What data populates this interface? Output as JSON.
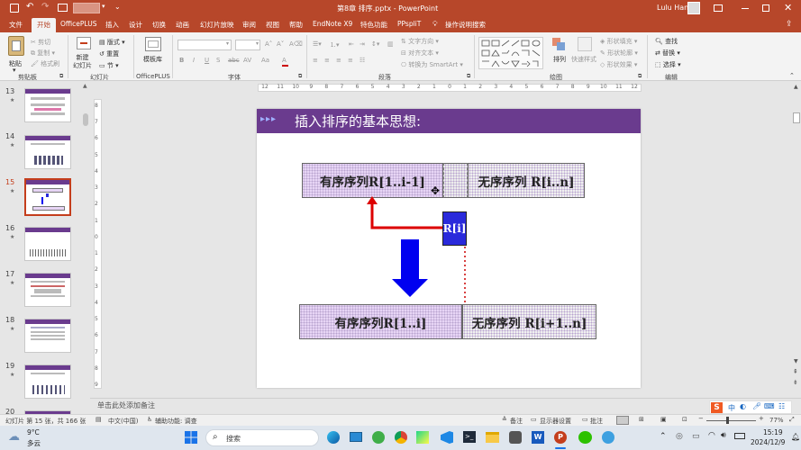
{
  "titlebar": {
    "doc_title": "第8章 排序.pptx - PowerPoint",
    "user": "Lulu Han"
  },
  "tabs": [
    "文件",
    "开始",
    "OfficePLUS",
    "插入",
    "设计",
    "切换",
    "动画",
    "幻灯片放映",
    "审阅",
    "视图",
    "帮助",
    "EndNote X9",
    "特色功能",
    "PPspliT",
    "操作说明搜索"
  ],
  "ribbon": {
    "paste": "粘贴",
    "cut": "剪切",
    "copy": "复制",
    "format_painter": "格式刷",
    "new_slide": "新建\n幻灯片",
    "layout": "版式",
    "reset": "重置",
    "section": "节",
    "template_lib": "模板库",
    "font_name": "",
    "font_size": "",
    "text_direction": "文字方向",
    "align_text": "对齐文本",
    "smartart": "转换为 SmartArt",
    "arrange": "排列",
    "quick_styles": "快速样式",
    "shape_fill": "形状填充",
    "shape_outline": "形状轮廓",
    "shape_effects": "形状效果",
    "find": "查找",
    "replace": "替换",
    "select": "选择",
    "groups": {
      "clipboard": "剪贴板",
      "slides": "幻灯片",
      "officeplus": "OfficePLUS",
      "font": "字体",
      "paragraph": "段落",
      "drawing": "绘图",
      "editing": "编辑"
    }
  },
  "thumbnails": [
    {
      "num": "13"
    },
    {
      "num": "14"
    },
    {
      "num": "15"
    },
    {
      "num": "16"
    },
    {
      "num": "17"
    },
    {
      "num": "18"
    },
    {
      "num": "19"
    },
    {
      "num": "20"
    }
  ],
  "slide": {
    "title": "插入排序的基本思想:",
    "top_sorted": "有序序列R[1..i-1]",
    "top_unsorted": "无序序列 R[i..n]",
    "ri": "R[i]",
    "bottom_sorted": "有序序列R[1..i]",
    "bottom_unsorted": "无序序列 R[i+1..n]"
  },
  "notes_placeholder": "单击此处添加备注",
  "ruler": {
    "h_ticks": [
      "12",
      "11",
      "10",
      "9",
      "8",
      "7",
      "6",
      "5",
      "4",
      "3",
      "2",
      "1",
      "0",
      "1",
      "2",
      "3",
      "4",
      "5",
      "6",
      "7",
      "8",
      "9",
      "10",
      "11",
      "12"
    ],
    "v_ticks": [
      "8",
      "7",
      "6",
      "5",
      "4",
      "3",
      "2",
      "1",
      "0",
      "1",
      "2",
      "3",
      "4",
      "5",
      "6",
      "7",
      "8",
      "9"
    ]
  },
  "status": {
    "slide_info": "幻灯片 第 15 张，共 166 张",
    "language": "中文(中国)",
    "accessibility": "辅助功能: 调查",
    "notes": "备注",
    "display_settings": "显示器设置",
    "comments": "批注",
    "zoom": "77%"
  },
  "taskbar": {
    "weather_temp": "9°C",
    "weather_desc": "多云",
    "search": "搜索",
    "time": "15:19",
    "date": "2024/12/9",
    "ime": "中"
  },
  "colors": {
    "accent": "#b7472a",
    "slide_title_bar": "#6a3b8e",
    "box_fill": "#e7d5f5",
    "ri_fill": "#2a2adb",
    "blue_arrow": "#0000f0",
    "red_arrow": "#dd0000"
  }
}
